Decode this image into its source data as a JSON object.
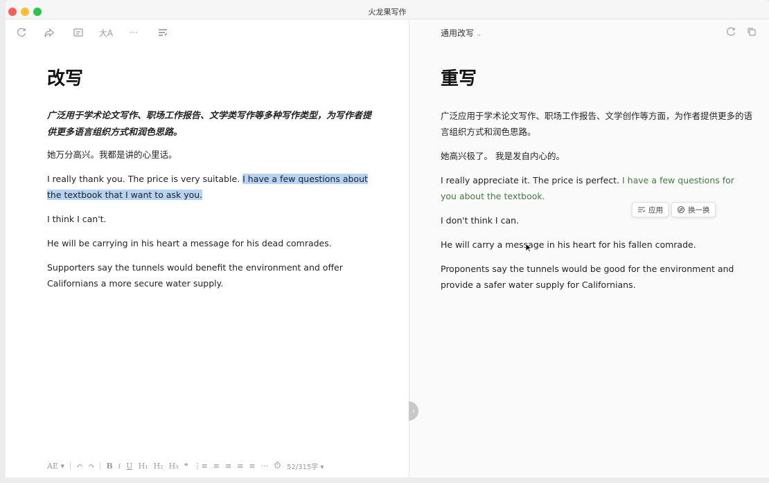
{
  "window": {
    "title": "火龙果写作"
  },
  "left": {
    "toolbar": [
      "refresh-icon",
      "share-icon",
      "mail-icon",
      "font-size-icon",
      "more-icon",
      "format-icon"
    ],
    "font_size_label": "大A",
    "more_label": "···",
    "title": "改写",
    "subtitle": "广泛用于学术论文写作、职场工作报告、文学类写作等多种写作类型，为写作者提供更多语言组织方式和润色思路。",
    "paragraphs": [
      {
        "text": "她万分高兴。我都是讲的心里话。"
      },
      {
        "plain": "I really thank you. The price is very suitable. ",
        "highlight": "I have a few questions about the textbook that I want to ask you."
      },
      {
        "text": "I think I can't."
      },
      {
        "text": "He will be carrying in his heart a message for his dead comrades."
      },
      {
        "text": "Supporters say the tunnels would benefit the environment and offer Californians a more secure water supply."
      }
    ],
    "bottom_toolbar": {
      "style": "AE ▾",
      "undo": "↶",
      "redo": "↷",
      "bold": "B",
      "italic": "i",
      "underline": "U",
      "h1": "H₁",
      "h2": "H₂",
      "h3": "H₃",
      "quote": "❝",
      "ol": "⋮≡",
      "ul": "≡",
      "align_left": "≡",
      "align_center": "≡",
      "align_right": "≡",
      "more": "···",
      "word_count": "52/315字 ▾"
    }
  },
  "right": {
    "mode": "通用改写",
    "title": "重写",
    "paragraphs": [
      {
        "text": "广泛应用于学术论文写作、职场工作报告、文学创作等方面，为作者提供更多的语言组织方式和润色思路。"
      },
      {
        "text": "她高兴极了。 我是发自内心的。"
      },
      {
        "plain": "I really appreciate it. The price is perfect. ",
        "highlight": "I have a few questions for you about the textbook."
      },
      {
        "text": "I don't think I can."
      },
      {
        "text": "He will carry a message in his heart for his fallen comrade."
      },
      {
        "text": "Proponents say the tunnels would be good for the environment and provide a safer water supply for Californians."
      }
    ],
    "popup": {
      "apply_label": "应用",
      "swap_label": "换一换"
    }
  }
}
